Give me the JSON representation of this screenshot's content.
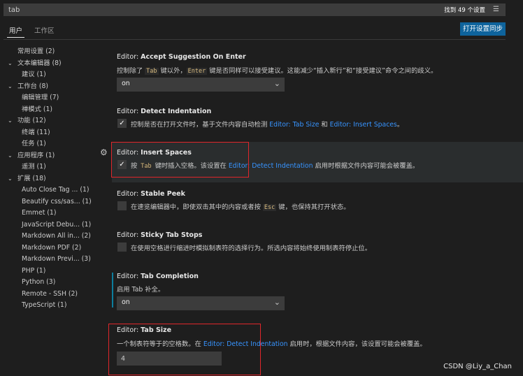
{
  "search": {
    "query": "tab",
    "result_count": "找到 49 个设置",
    "filter_icon": "list-filter-icon"
  },
  "tabs": [
    {
      "label": "用户"
    },
    {
      "label": "工作区"
    }
  ],
  "sync_button": "打开设置同步",
  "tree": [
    {
      "label": "常用设置 (2)",
      "chev": "",
      "indent": 1
    },
    {
      "label": "文本编辑器 (8)",
      "chev": "⌄",
      "indent": 1
    },
    {
      "label": "建议 (1)",
      "chev": "",
      "indent": 2
    },
    {
      "label": "工作台 (8)",
      "chev": "⌄",
      "indent": 1
    },
    {
      "label": "编辑管理 (7)",
      "chev": "",
      "indent": 2
    },
    {
      "label": "禅模式 (1)",
      "chev": "",
      "indent": 2
    },
    {
      "label": "功能 (12)",
      "chev": "⌄",
      "indent": 1
    },
    {
      "label": "终端 (11)",
      "chev": "",
      "indent": 2
    },
    {
      "label": "任务 (1)",
      "chev": "",
      "indent": 2
    },
    {
      "label": "应用程序 (1)",
      "chev": "⌄",
      "indent": 1
    },
    {
      "label": "遥测 (1)",
      "chev": "",
      "indent": 2
    },
    {
      "label": "扩展 (18)",
      "chev": "⌄",
      "indent": 1
    },
    {
      "label": "Auto Close Tag ... (1)",
      "chev": "",
      "indent": 2
    },
    {
      "label": "Beautify css/sas... (1)",
      "chev": "",
      "indent": 2
    },
    {
      "label": "Emmet (1)",
      "chev": "",
      "indent": 2
    },
    {
      "label": "JavaScript Debu... (1)",
      "chev": "",
      "indent": 2
    },
    {
      "label": "Markdown All in... (2)",
      "chev": "",
      "indent": 2
    },
    {
      "label": "Markdown PDF (2)",
      "chev": "",
      "indent": 2
    },
    {
      "label": "Markdown Previ... (3)",
      "chev": "",
      "indent": 2
    },
    {
      "label": "PHP (1)",
      "chev": "",
      "indent": 2
    },
    {
      "label": "Python (3)",
      "chev": "",
      "indent": 2
    },
    {
      "label": "Remote - SSH (2)",
      "chev": "",
      "indent": 2
    },
    {
      "label": "TypeScript (1)",
      "chev": "",
      "indent": 2
    }
  ],
  "settings": {
    "accept_suggestion": {
      "category": "Editor: ",
      "name": "Accept Suggestion On Enter",
      "desc_1": "控制除了 ",
      "code_1": "Tab",
      "desc_2": " 键以外，",
      "code_2": "Enter",
      "desc_3": " 键是否同样可以接受建议。这能减少“插入新行”和“接受建议”命令之间的歧义。",
      "value": "on"
    },
    "detect_indentation": {
      "category": "Editor: ",
      "name": "Detect Indentation",
      "desc_1": "控制是否在打开文件时，基于文件内容自动检测 ",
      "link_1": "Editor: Tab Size",
      "desc_2": " 和 ",
      "link_2": "Editor: Insert Spaces",
      "desc_3": "。",
      "checked": true
    },
    "insert_spaces": {
      "category": "Editor: ",
      "name": "Insert Spaces",
      "desc_1": "按 ",
      "code_1": "Tab",
      "desc_2": " 键时插入空格。该设置在 ",
      "link_1": "Editor: Detect Indentation",
      "desc_3": " 启用时根据文件内容可能会被覆盖。",
      "checked": true
    },
    "stable_peek": {
      "category": "Editor: ",
      "name": "Stable Peek",
      "desc_1": "在速览编辑器中，即使双击其中的内容或者按 ",
      "code_1": "Esc",
      "desc_2": " 键，也保持其打开状态。",
      "checked": false
    },
    "sticky_tab_stops": {
      "category": "Editor: ",
      "name": "Sticky Tab Stops",
      "desc_1": "在使用空格进行缩进时模拟制表符的选择行为。所选内容将始终使用制表符停止位。",
      "checked": false
    },
    "tab_completion": {
      "category": "Editor: ",
      "name": "Tab Completion",
      "desc_1": "启用 Tab 补全。",
      "value": "on"
    },
    "tab_size": {
      "category": "Editor: ",
      "name": "Tab Size",
      "desc_1": "一个制表符等于的空格数。在 ",
      "link_1": "Editor: Detect Indentation",
      "desc_2": " 启用时，根据文件内容，该设置可能会被覆盖。",
      "value": "4"
    }
  },
  "colors": {
    "link": "#3794ff",
    "highlight_box": "#e0262b",
    "sync_button": "#0e639c"
  },
  "watermark": "CSDN @Liy_a_Chan"
}
